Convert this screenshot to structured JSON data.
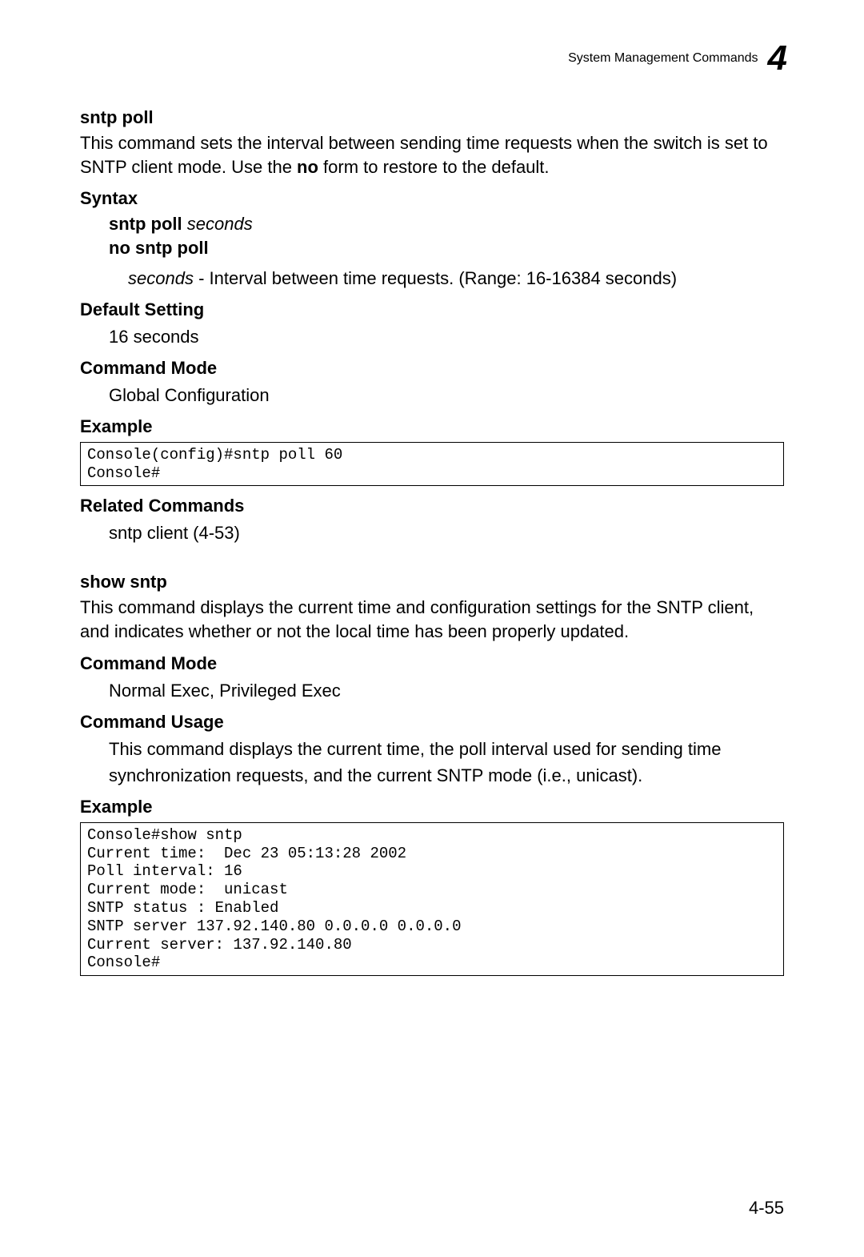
{
  "header": {
    "title": "System Management Commands",
    "chapter": "4"
  },
  "cmd1": {
    "title": "sntp poll",
    "desc_pre": "This command sets the interval between sending time requests when the switch is set to SNTP client mode. Use the ",
    "desc_bold": "no",
    "desc_post": " form to restore to the default."
  },
  "syntax": {
    "head": "Syntax",
    "l1_kw": "sntp poll",
    "l1_arg": "seconds",
    "l2_kw": "no sntp poll",
    "param_arg": "seconds",
    "param_desc": " - Interval between time requests. (Range: 16-16384 seconds)"
  },
  "defset": {
    "head": "Default Setting",
    "val": "16 seconds"
  },
  "mode1": {
    "head": "Command Mode",
    "val": "Global Configuration"
  },
  "ex1": {
    "head": "Example",
    "code": "Console(config)#sntp poll 60\nConsole#"
  },
  "related": {
    "head": "Related Commands",
    "val": "sntp client (4-53)"
  },
  "cmd2": {
    "title": "show sntp",
    "desc": "This command displays the current time and configuration settings for the SNTP client, and indicates whether or not the local time has been properly updated."
  },
  "mode2": {
    "head": "Command Mode",
    "val": "Normal Exec, Privileged Exec"
  },
  "usage": {
    "head": "Command Usage",
    "val": "This command displays the current time, the poll interval used for sending time synchronization requests, and the current SNTP mode (i.e., unicast)."
  },
  "ex2": {
    "head": "Example",
    "code": "Console#show sntp\nCurrent time:  Dec 23 05:13:28 2002\nPoll interval: 16\nCurrent mode:  unicast\nSNTP status : Enabled\nSNTP server 137.92.140.80 0.0.0.0 0.0.0.0\nCurrent server: 137.92.140.80\nConsole#"
  },
  "pagenum": "4-55"
}
